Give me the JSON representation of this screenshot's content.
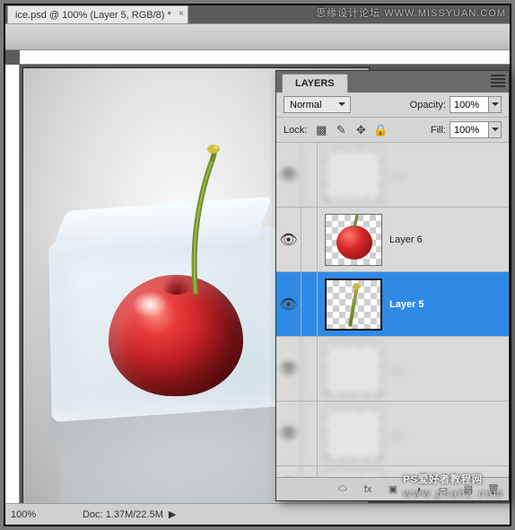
{
  "document": {
    "tab_title": "ice.psd @ 100% (Layer 5, RGB/8) *"
  },
  "status": {
    "zoom": "100%",
    "doc_info": "Doc: 1.37M/22.5M",
    "arrow": "▶"
  },
  "layers_panel": {
    "title": "LAYERS",
    "blend_mode": "Normal",
    "opacity_label": "Opacity:",
    "opacity_value": "100%",
    "lock_label": "Lock:",
    "fill_label": "Fill:",
    "fill_value": "100%",
    "icons": {
      "transparency": "▩",
      "brush": "✎",
      "move": "✥",
      "all": "🔒"
    },
    "layers": [
      {
        "name": "Layer 6",
        "visible": true,
        "selected": false,
        "type": "cherry"
      },
      {
        "name": "Layer 5",
        "visible": true,
        "selected": true,
        "type": "stem"
      }
    ],
    "footer_icons": {
      "link": "⬭",
      "fx": "fx",
      "mask": "▣",
      "adjust": "◑",
      "group": "▭",
      "new": "▤",
      "trash": "🗑"
    }
  },
  "watermarks": {
    "top": "思缘设计论坛 WWW.MISSYUAN.COM",
    "bottom_main": "PS爱好者教程网",
    "bottom_sub": "www.psahz.com"
  }
}
